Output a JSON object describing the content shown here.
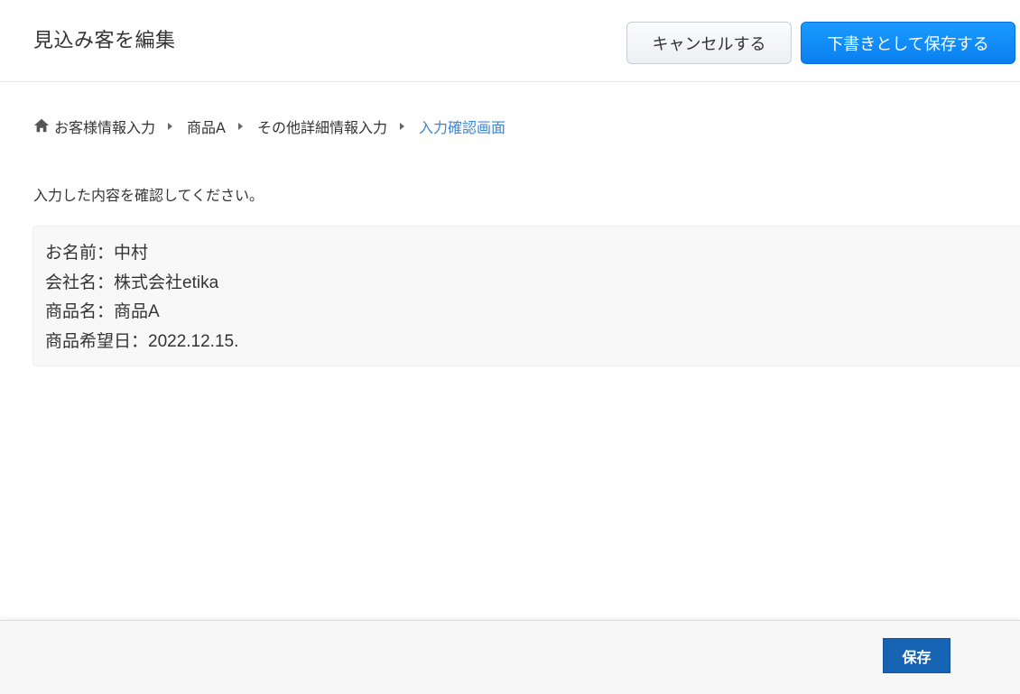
{
  "header": {
    "title": "見込み客を編集",
    "cancel_label": "キャンセルする",
    "draft_label": "下書きとして保存する"
  },
  "breadcrumb": {
    "items": [
      "お客様情報入力",
      "商品A",
      "その他詳細情報入力",
      "入力確認画面"
    ],
    "current_index": 3
  },
  "main": {
    "instruction": "入力した内容を確認してください。",
    "confirm_lines": [
      "お名前：中村",
      "会社名：株式会社etika",
      "商品名：商品A",
      "商品希望日：2022.12.15."
    ]
  },
  "footer": {
    "save_label": "保存"
  },
  "colors": {
    "primary": "#0a7ff0",
    "save": "#1764b5",
    "breadcrumb_current": "#3b86d8"
  },
  "icons": {
    "home": "home-icon",
    "separator": "chevron-right-icon"
  }
}
